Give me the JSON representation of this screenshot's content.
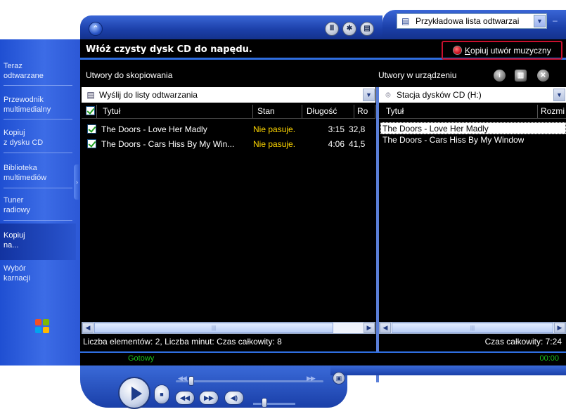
{
  "header": {
    "title": "Włóż czysty dysk CD do napędu.",
    "copy_button": "Kopiuj utwór muzyczny",
    "copy_button_key": "K",
    "copy_button_rest": "opiuj utwór muzyczny"
  },
  "topbar": {
    "playlist_selected": "Przykładowa lista odtwarzai",
    "buttons": [
      "eq-icon",
      "visualization-icon",
      "info-icon"
    ]
  },
  "taskbar": {
    "items": [
      {
        "line1": "Teraz",
        "line2": "odtwarzane"
      },
      {
        "line1": "Przewodnik",
        "line2": "multimedialny"
      },
      {
        "line1": "Kopiuj",
        "line2": "z dysku CD"
      },
      {
        "line1": "Biblioteka",
        "line2": "multimediów"
      },
      {
        "line1": "Tuner",
        "line2": "radiowy"
      },
      {
        "line1": "Kopiuj",
        "line2": "na..."
      },
      {
        "line1": "Wybór",
        "line2": "karnacji"
      }
    ],
    "active_index": 5
  },
  "left_pane": {
    "title": "Utwory do skopiowania",
    "combo": "Wyślij do listy odtwarzania",
    "columns": [
      "Tytuł",
      "Stan",
      "Długość",
      "Ro"
    ],
    "rows": [
      {
        "title": "The Doors - Love Her Madly",
        "status": "Nie pasuje.",
        "length": "3:15",
        "size": "32,8"
      },
      {
        "title": "The Doors - Cars Hiss By My Win...",
        "status": "Nie pasuje.",
        "length": "4:06",
        "size": "41,5"
      }
    ],
    "summary": "Liczba elementów: 2, Liczba minut: Czas całkowity: 8"
  },
  "right_pane": {
    "title": "Utwory w urządzeniu",
    "combo": "Stacja dysków CD (H:)",
    "columns": [
      "Tytuł",
      "Rozmi"
    ],
    "rows": [
      {
        "title": "The Doors - Love Her Madly"
      },
      {
        "title": "The Doors - Cars Hiss By My Window"
      }
    ],
    "summary": "Czas całkowity: 7:24"
  },
  "status": {
    "state": "Gotowy",
    "time": "00:00"
  },
  "colors": {
    "accent_blue": "#2f6ee0",
    "status_green": "#1cc51c",
    "mismatch_yellow": "#ffd700",
    "record_border": "#c8102e"
  }
}
